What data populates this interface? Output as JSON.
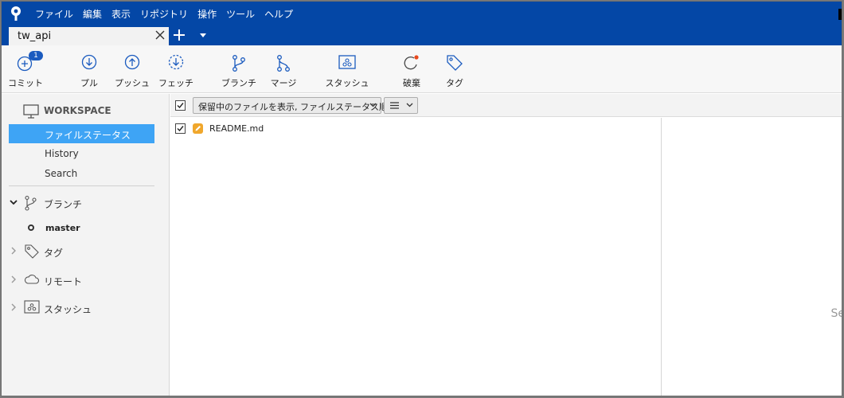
{
  "menubar": {
    "items": [
      "ファイル",
      "編集",
      "表示",
      "リポジトリ",
      "操作",
      "ツール",
      "ヘルプ"
    ]
  },
  "tabs": {
    "active_label": "tw_api"
  },
  "toolbar": {
    "commit_label": "コミット",
    "commit_badge": "1",
    "pull_label": "プル",
    "push_label": "プッシュ",
    "fetch_label": "フェッチ",
    "branch_label": "ブランチ",
    "merge_label": "マージ",
    "stash_label": "スタッシュ",
    "discard_label": "破棄",
    "tag_label": "タグ"
  },
  "sidebar": {
    "workspace_label": "WORKSPACE",
    "items": [
      {
        "label": "ファイルステータス",
        "selected": true
      },
      {
        "label": "History",
        "selected": false
      },
      {
        "label": "Search",
        "selected": false
      }
    ],
    "groups": {
      "branches": "ブランチ",
      "tags": "タグ",
      "remotes": "リモート",
      "stashes": "スタッシュ"
    },
    "current_branch": "master"
  },
  "filter": {
    "dropdown_label": "保留中のファイルを表示, ファイルステータス順",
    "view_icon": "list-icon"
  },
  "files": [
    {
      "name": "README.md",
      "status": "modified",
      "checked": true
    }
  ],
  "diff": {
    "hint_partial": "Se"
  },
  "colors": {
    "title_bar": "#0447a6",
    "selection": "#3ea4f5",
    "modified_file": "#f0a72c",
    "icon_blue": "#1b5bbf",
    "discard_dot": "#e8491d"
  }
}
